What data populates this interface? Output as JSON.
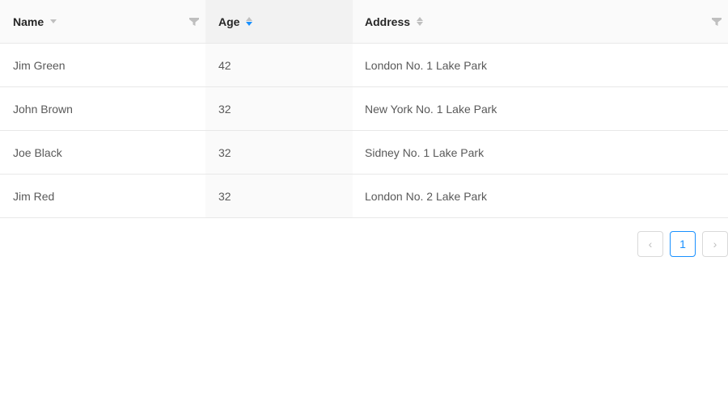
{
  "columns": {
    "name": {
      "label": "Name",
      "sort": "descend-hint",
      "filter_icon": "filter-icon"
    },
    "age": {
      "label": "Age",
      "sort": "descend",
      "sort_color": "#1890ff"
    },
    "address": {
      "label": "Address",
      "filter_icon": "filter-icon"
    }
  },
  "rows": [
    {
      "name": "Jim Green",
      "age": "42",
      "address": "London No. 1 Lake Park"
    },
    {
      "name": "John Brown",
      "age": "32",
      "address": "New York No. 1 Lake Park"
    },
    {
      "name": "Joe Black",
      "age": "32",
      "address": "Sidney No. 1 Lake Park"
    },
    {
      "name": "Jim Red",
      "age": "32",
      "address": "London No. 2 Lake Park"
    }
  ],
  "pagination": {
    "prev_icon": "‹",
    "current_page": "1",
    "next_icon": "›"
  }
}
